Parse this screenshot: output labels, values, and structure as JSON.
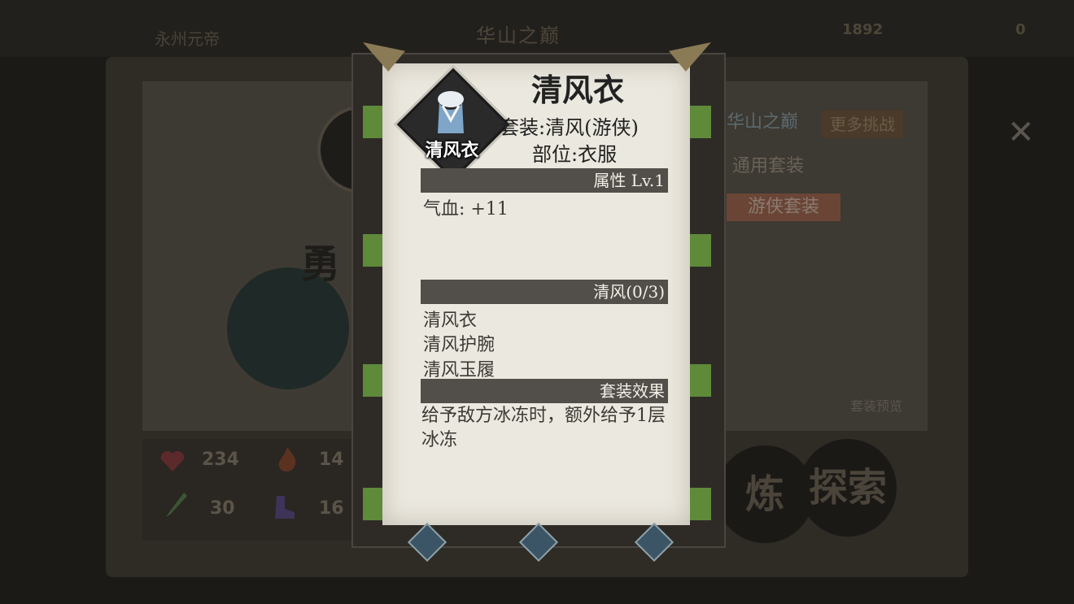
{
  "background": {
    "location_left": "永州元帝",
    "title": "华山之巅",
    "coins": "1892",
    "gems": "0",
    "stats": {
      "hp": "234",
      "attack": "14",
      "defense": "30",
      "speed": "16"
    },
    "right_panel": {
      "header": "华山之巅",
      "challenge_button": "更多挑战",
      "general_sets": "通用套装",
      "ranger_sets": "游侠套装"
    },
    "set_preview": "套装预览",
    "explore_button": "探索",
    "refine_button": "炼"
  },
  "popup": {
    "title": "清风衣",
    "icon_label": "清风衣",
    "set_line": "套装:清风(游侠)",
    "slot_line": "部位:衣服",
    "attributes_header": "属性 Lv.1",
    "attributes": [
      "气血: +11"
    ],
    "set_header": "清风(0/3)",
    "set_items": [
      "清风衣",
      "清风护腕",
      "清风玉履"
    ],
    "effect_header": "套装效果",
    "effect_text": "给予敌方冰冻时，额外给予1层冰冻"
  },
  "colors": {
    "paper": "#ebe8df",
    "bar": "#524e49",
    "frame": "#2e2b27",
    "tab_green": "#5e8a3a"
  },
  "icons": [
    "gear-ornament-icon",
    "robe-icon",
    "close-icon",
    "heart-icon",
    "flame-icon",
    "sword-icon",
    "boot-icon",
    "diamond-icon"
  ]
}
